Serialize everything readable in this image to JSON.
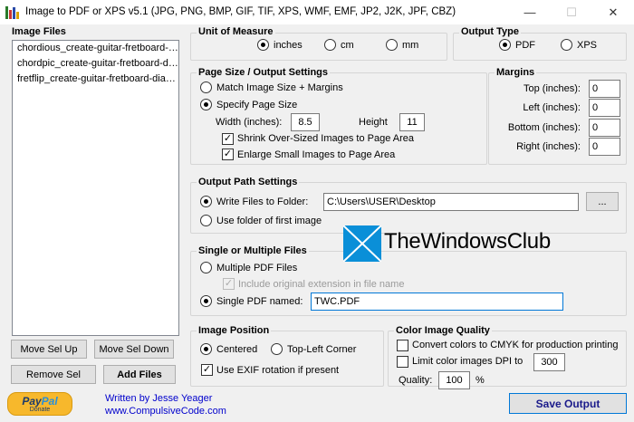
{
  "window": {
    "title": "Image to PDF or XPS  v5.1  (JPG, PNG, BMP, GIF, TIF, XPS, WMF, EMF, JP2, J2K, JPF, CBZ)",
    "minimize_glyph": "—",
    "maximize_glyph": "☐",
    "close_glyph": "✕"
  },
  "image_files": {
    "label": "Image Files",
    "items": [
      "chordious_create-guitar-fretboard-diagrams.png",
      "chordpic_create-guitar-fretboard-diagrams.png",
      "fretflip_create-guitar-fretboard-diagrams.png"
    ],
    "move_up": "Move Sel Up",
    "move_down": "Move Sel Down",
    "remove": "Remove Sel",
    "add": "Add Files"
  },
  "unit": {
    "label": "Unit of Measure",
    "options": [
      "inches",
      "cm",
      "mm"
    ],
    "selected": "inches"
  },
  "output_type": {
    "label": "Output Type",
    "options": [
      "PDF",
      "XPS"
    ],
    "selected": "PDF"
  },
  "page_size": {
    "label": "Page Size / Output Settings",
    "match": "Match Image Size + Margins",
    "specify": "Specify Page Size",
    "width_label": "Width (inches):",
    "width": "8.5",
    "height_label": "Height",
    "height": "11",
    "shrink": "Shrink Over-Sized Images to Page Area",
    "enlarge": "Enlarge Small Images to Page Area"
  },
  "margins": {
    "label": "Margins",
    "top_label": "Top (inches):",
    "top": "0",
    "left_label": "Left (inches):",
    "left": "0",
    "bottom_label": "Bottom (inches):",
    "bottom": "0",
    "right_label": "Right (inches):",
    "right": "0"
  },
  "output_path": {
    "label": "Output Path Settings",
    "write_label": "Write Files to Folder:",
    "folder": "C:\\Users\\USER\\Desktop",
    "browse": "...",
    "use_first": "Use folder of first image"
  },
  "watermark": {
    "text": "TheWindowsClub"
  },
  "single_multiple": {
    "label": "Single or Multiple Files",
    "multiple": "Multiple PDF Files",
    "include_ext": "Include original extension in file name",
    "single": "Single PDF named:",
    "filename": "TWC.PDF"
  },
  "image_position": {
    "label": "Image Position",
    "centered": "Centered",
    "top_left": "Top-Left Corner",
    "exif": "Use EXIF rotation if present"
  },
  "color_quality": {
    "label": "Color Image Quality",
    "cmyk": "Convert colors to CMYK for production printing",
    "limit_dpi": "Limit color images DPI to",
    "dpi": "300",
    "quality_label": "Quality:",
    "quality": "100",
    "percent": "%"
  },
  "footer": {
    "paypal_pay": "Pay",
    "paypal_pal": "Pal",
    "paypal_donate": "Donate",
    "author": "Written by Jesse Yeager",
    "website": "www.CompulsiveCode.com",
    "save": "Save Output"
  },
  "colors": {
    "accent": "#0078d7",
    "link": "#0000cc",
    "paypal_gold": "#f7b82c",
    "paypal_navy": "#1b3a6b",
    "paypal_cyan": "#2b8fd6",
    "watermark_blue": "#0a8fd8"
  }
}
